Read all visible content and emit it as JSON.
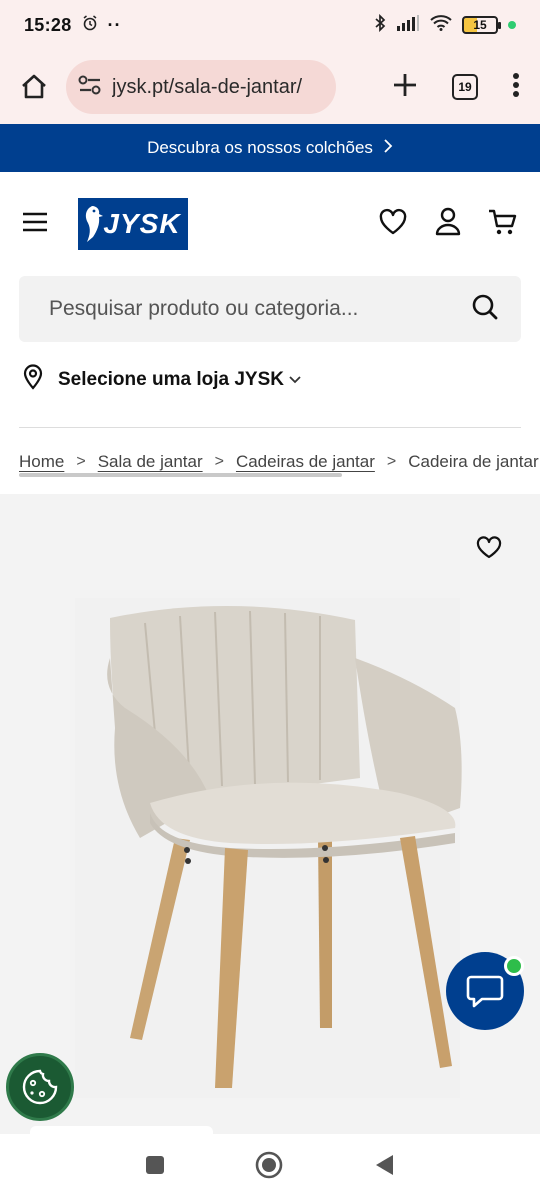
{
  "status_bar": {
    "time": "15:28",
    "battery_level": "15"
  },
  "browser": {
    "url": "jysk.pt/sala-de-jantar/",
    "tab_count": "19"
  },
  "promo_banner": {
    "text": "Descubra os nossos colchões"
  },
  "header": {
    "logo_text": "JYSK"
  },
  "search": {
    "placeholder": "Pesquisar produto ou categoria..."
  },
  "store": {
    "label": "Selecione uma loja JYSK"
  },
  "breadcrumb": {
    "items": [
      "Home",
      "Sala de jantar",
      "Cadeiras de jantar",
      "Cadeira de jantar"
    ]
  },
  "colors": {
    "brand_blue": "#003f8f",
    "browser_bg": "#fbefee",
    "url_pill": "#f5d9d6",
    "cookie_green": "#1b5a33",
    "online_green": "#2ebd4a"
  }
}
